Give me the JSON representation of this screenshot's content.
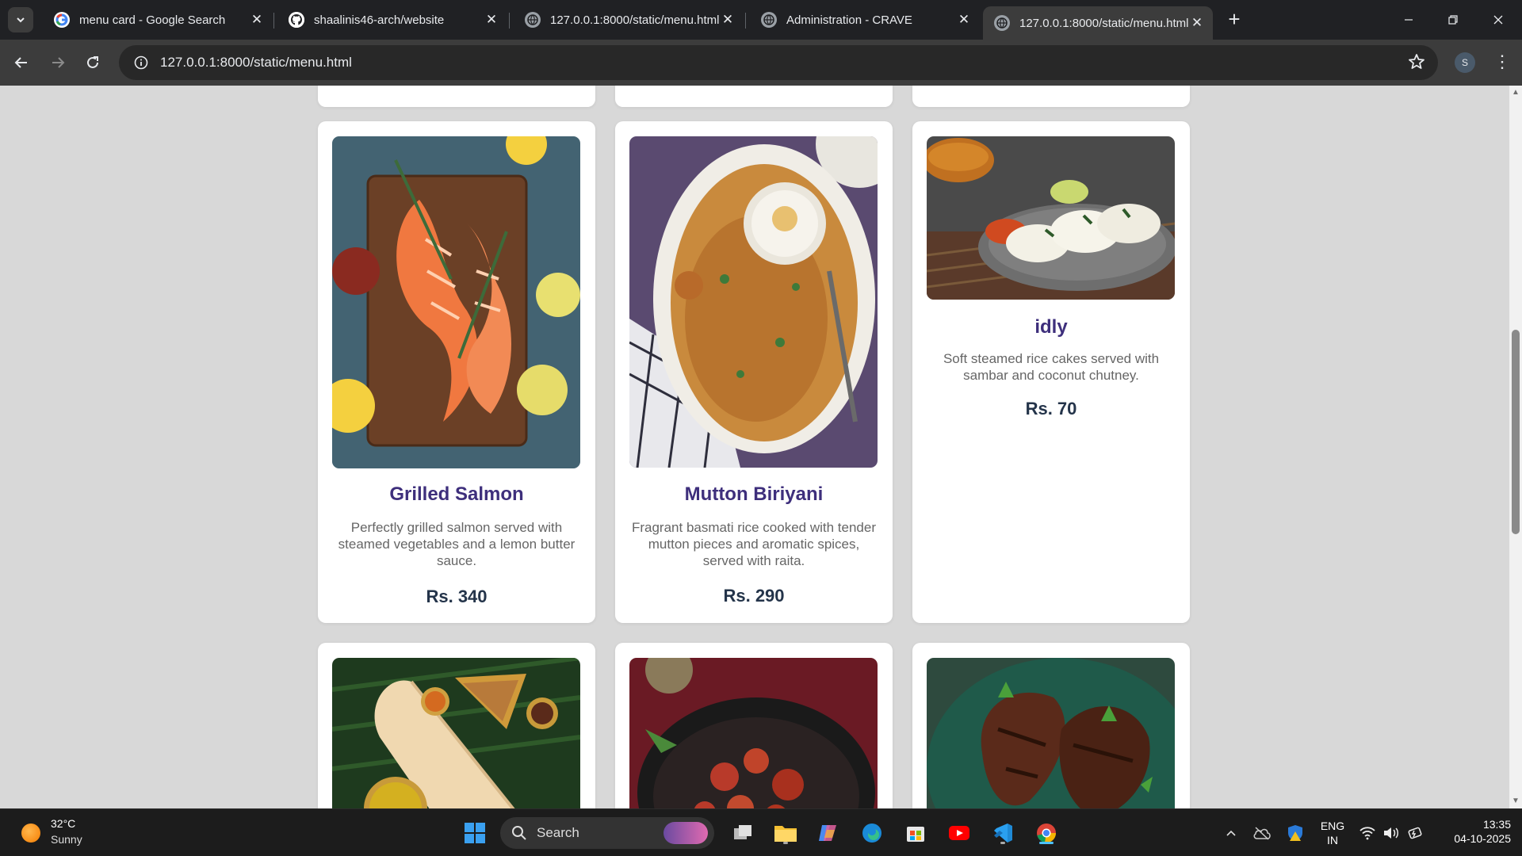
{
  "browser": {
    "tabs": [
      {
        "title": "menu card - Google Search",
        "favicon": "google-icon"
      },
      {
        "title": "shaalinis46-arch/website",
        "favicon": "github-icon"
      },
      {
        "title": "127.0.0.1:8000/static/menu.html",
        "favicon": "globe-icon"
      },
      {
        "title": "Administration - CRAVE",
        "favicon": "globe-icon"
      },
      {
        "title": "127.0.0.1:8000/static/menu.html",
        "favicon": "globe-icon",
        "active": true
      }
    ],
    "url": "127.0.0.1:8000/static/menu.html",
    "profile_initial": "S"
  },
  "menu": {
    "items": [
      {
        "name": "Grilled Salmon",
        "description": "Perfectly grilled salmon served with steamed vegetables and a lemon butter sauce.",
        "price": "Rs. 340",
        "image": "grilled-salmon-photo"
      },
      {
        "name": "Mutton Biriyani",
        "description": "Fragrant basmati rice cooked with tender mutton pieces and aromatic spices, served with raita.",
        "price": "Rs. 290",
        "image": "mutton-biriyani-photo"
      },
      {
        "name": "idly",
        "description": "Soft steamed rice cakes served with sambar and coconut chutney.",
        "price": "Rs. 70",
        "image": "idly-photo"
      }
    ],
    "next_row_images": [
      "dosa-photo",
      "chicken-fry-photo",
      "grilled-chicken-photo"
    ],
    "colors": {
      "title": "#3e2f7c",
      "price": "#24344a",
      "page_bg": "#d8d8d8"
    }
  },
  "taskbar": {
    "weather_temp": "32°C",
    "weather_desc": "Sunny",
    "search_label": "Search",
    "lang_top": "ENG",
    "lang_bottom": "IN",
    "time": "13:35",
    "date": "04-10-2025"
  }
}
